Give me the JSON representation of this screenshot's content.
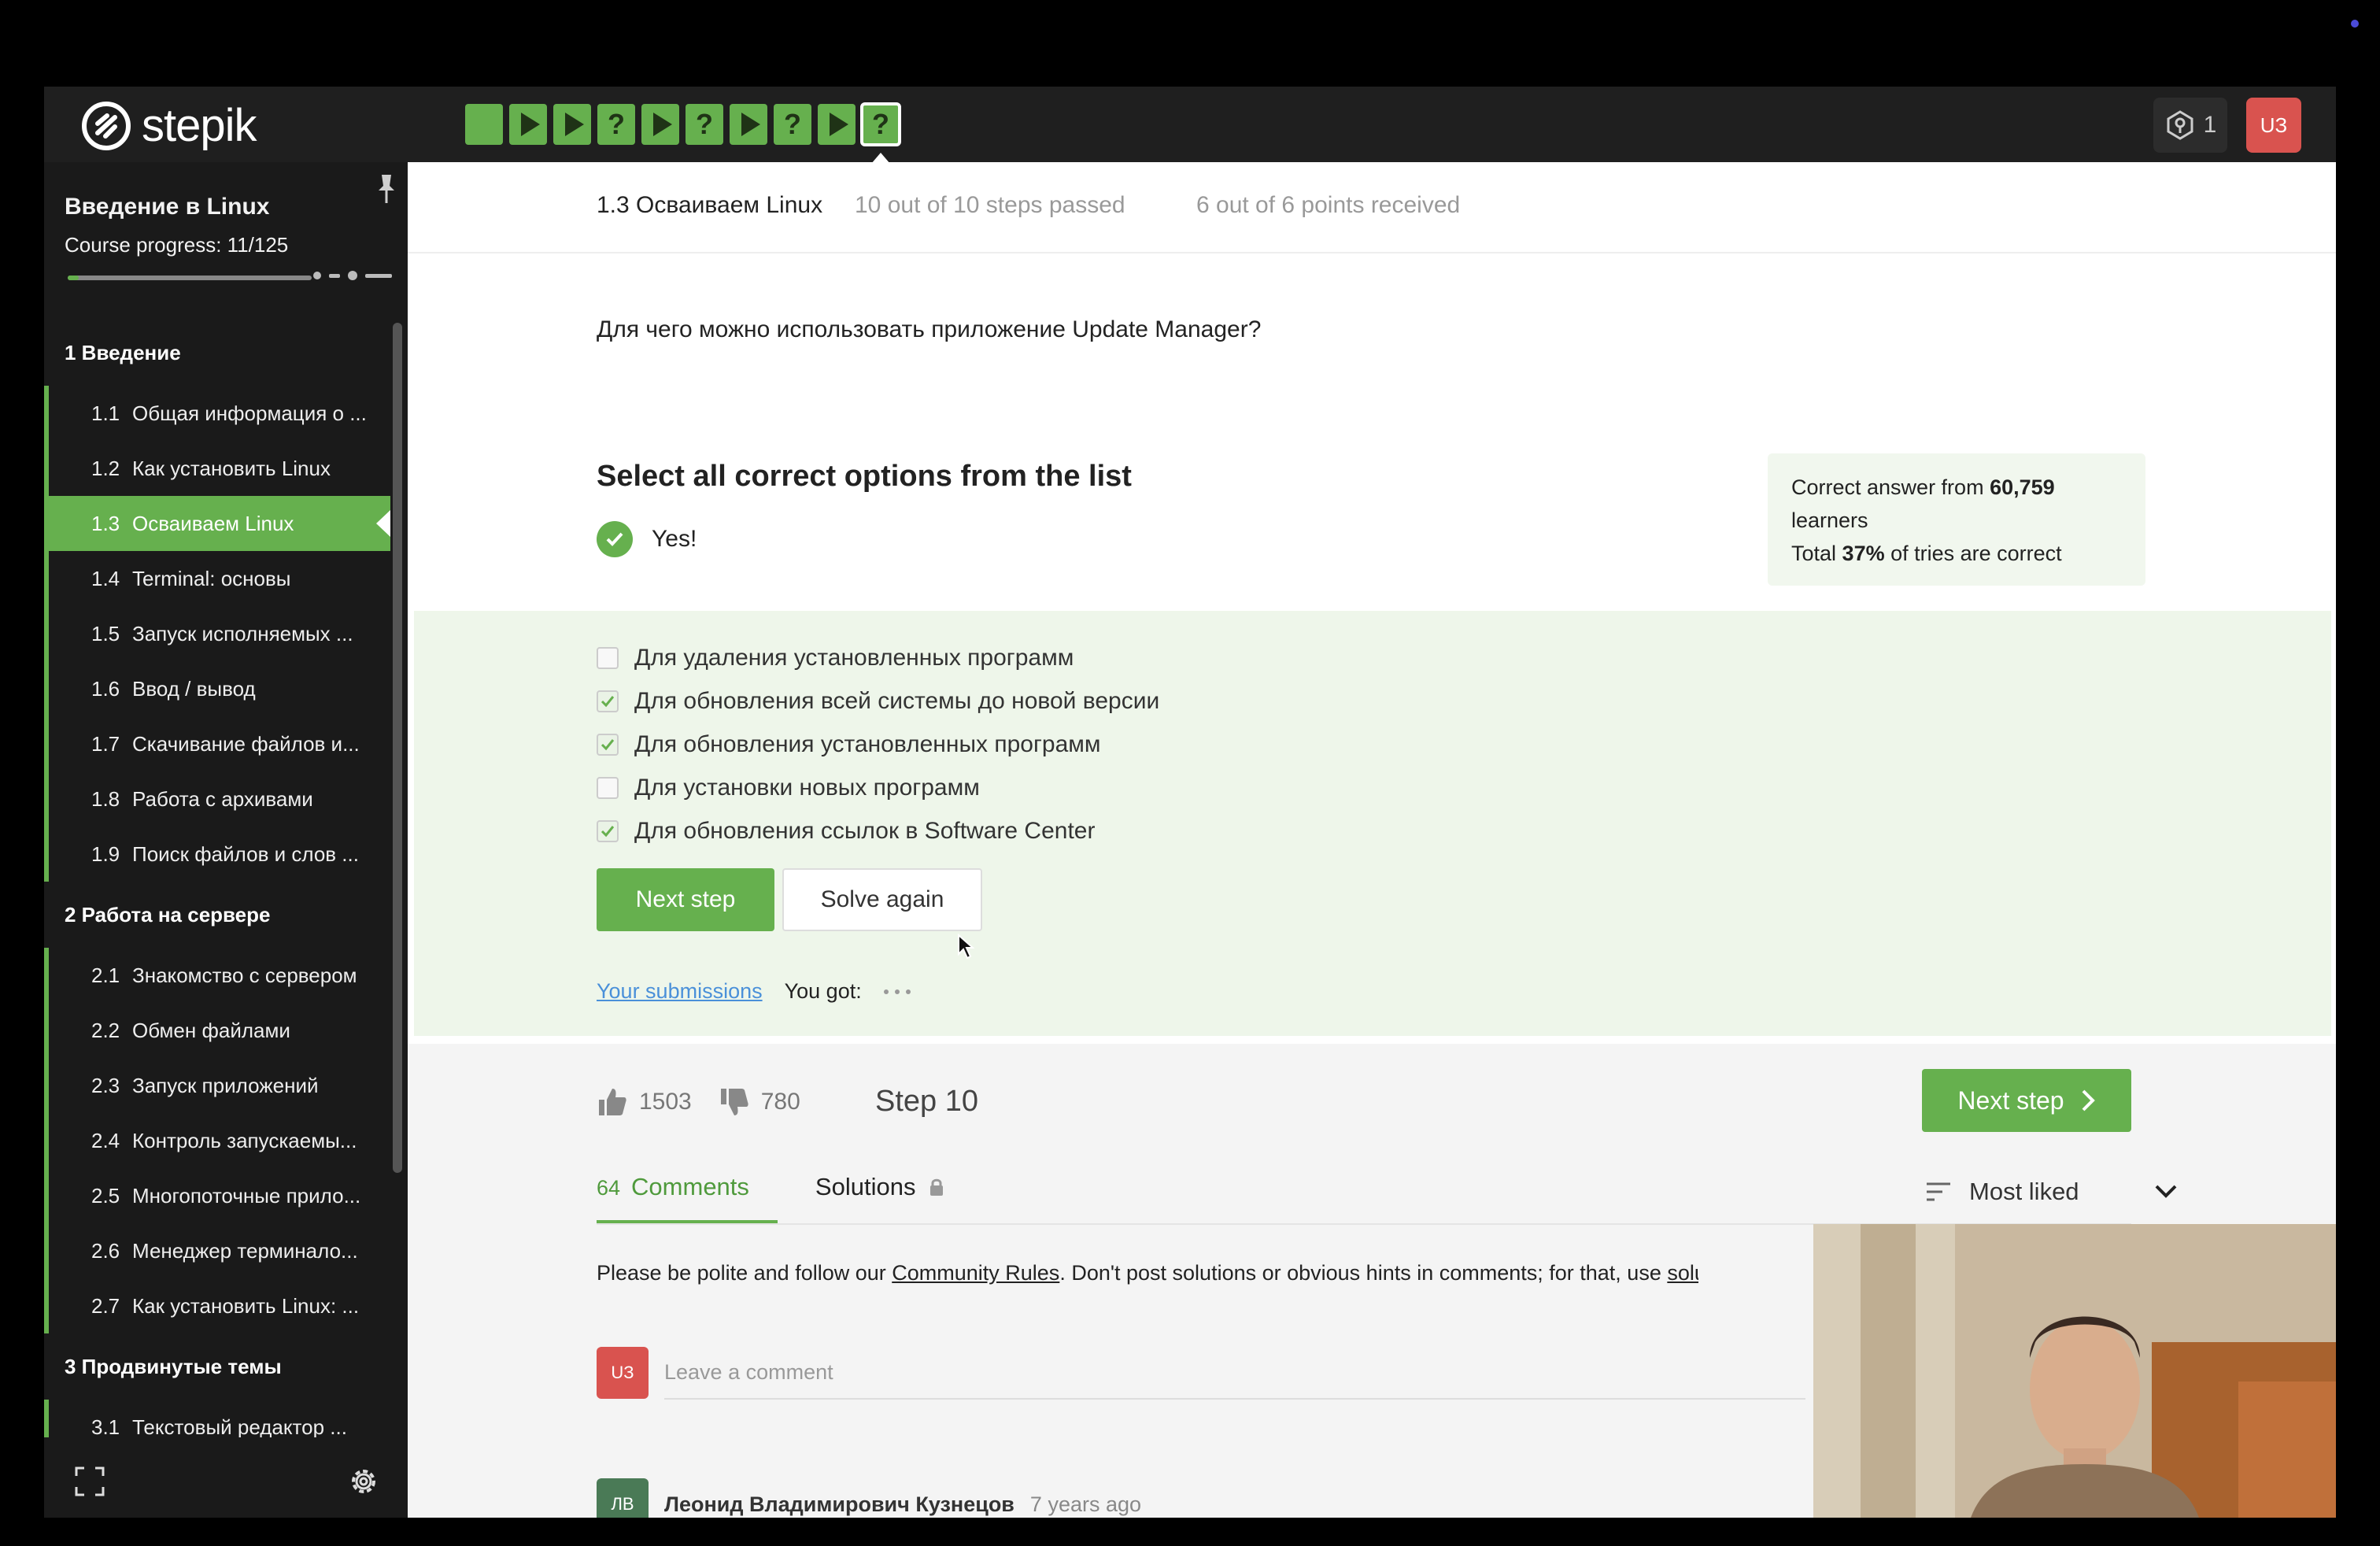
{
  "brand": {
    "name": "stepik"
  },
  "top_bar": {
    "step_icons": [
      "solid",
      "play",
      "play",
      "question",
      "play",
      "question",
      "play",
      "question",
      "play",
      "question"
    ],
    "current_step_index": 9,
    "notifications_count": "1",
    "user_initials": "UЗ"
  },
  "sidebar": {
    "course_title": "Введение в Linux",
    "course_progress": "Course progress:  11/125",
    "progress_value": 11,
    "progress_total": 125,
    "sections": [
      {
        "title": "1  Введение",
        "lessons": [
          {
            "num": "1.1",
            "label": "Общая информация о ..."
          },
          {
            "num": "1.2",
            "label": "Как установить Linux"
          },
          {
            "num": "1.3",
            "label": "Осваиваем Linux",
            "active": true
          },
          {
            "num": "1.4",
            "label": "Terminal: основы"
          },
          {
            "num": "1.5",
            "label": "Запуск исполняемых ..."
          },
          {
            "num": "1.6",
            "label": "Ввод / вывод"
          },
          {
            "num": "1.7",
            "label": "Скачивание файлов и..."
          },
          {
            "num": "1.8",
            "label": "Работа с архивами"
          },
          {
            "num": "1.9",
            "label": "Поиск файлов и слов ..."
          }
        ]
      },
      {
        "title": "2  Работа на сервере",
        "lessons": [
          {
            "num": "2.1",
            "label": "Знакомство с сервером"
          },
          {
            "num": "2.2",
            "label": "Обмен файлами"
          },
          {
            "num": "2.3",
            "label": "Запуск приложений"
          },
          {
            "num": "2.4",
            "label": "Контроль запускаемы..."
          },
          {
            "num": "2.5",
            "label": "Многопоточные прило..."
          },
          {
            "num": "2.6",
            "label": "Менеджер терминало..."
          },
          {
            "num": "2.7",
            "label": "Как установить Linux: ..."
          }
        ]
      },
      {
        "title": "3  Продвинутые темы",
        "lessons": [
          {
            "num": "3.1",
            "label": "Текстовый редактор ..."
          }
        ]
      }
    ]
  },
  "lesson_header": {
    "title": "1.3 Осваиваем Linux",
    "steps_passed": "10 out of 10 steps passed",
    "points": "6 out of 6 points  received"
  },
  "question": "Для чего можно использовать приложение Update Manager?",
  "quiz": {
    "title": "Select all correct options from the list",
    "result": "Yes!",
    "options": [
      {
        "label": "Для удаления установленных программ",
        "checked": false
      },
      {
        "label": "Для обновления всей системы до новой версии",
        "checked": true
      },
      {
        "label": "Для обновления установленных программ",
        "checked": true
      },
      {
        "label": "Для установки новых программ",
        "checked": false
      },
      {
        "label": "Для обновления ссылок в Software Center",
        "checked": true
      }
    ],
    "next_label": "Next step",
    "solve_again_label": "Solve again",
    "submissions_link": "Your submissions",
    "you_got": "You got:"
  },
  "stats": {
    "prefix": "Correct answer from ",
    "learners_count": "60,759",
    "learners_word": "learners",
    "total_prefix": "Total ",
    "percent": "37%",
    "total_suffix": " of tries are correct"
  },
  "footer": {
    "likes": "1503",
    "dislikes": "780",
    "step_label": "Step 10",
    "next_label": "Next step"
  },
  "discussion": {
    "comments_count": "64",
    "comments_tab": "Comments",
    "solutions_tab": "Solutions",
    "sort_label": "Most liked",
    "rules_prefix": "Please be polite and follow our ",
    "rules_link": "Community Rules",
    "rules_middle": ". Don't post solutions or obvious hints in comments; for that, use ",
    "rules_link2": "solutions f",
    "comment_placeholder": "Leave a comment",
    "user_initials": "UЗ",
    "first_comment": {
      "initials": "ЛВ",
      "author": "Леонид Владимирович Кузнецов",
      "time": "7 years ago"
    }
  },
  "colors": {
    "accent": "#66b04e",
    "topbar": "#1f1f1f",
    "sidebar": "#1a1a1a",
    "avatar": "#d9534f"
  }
}
